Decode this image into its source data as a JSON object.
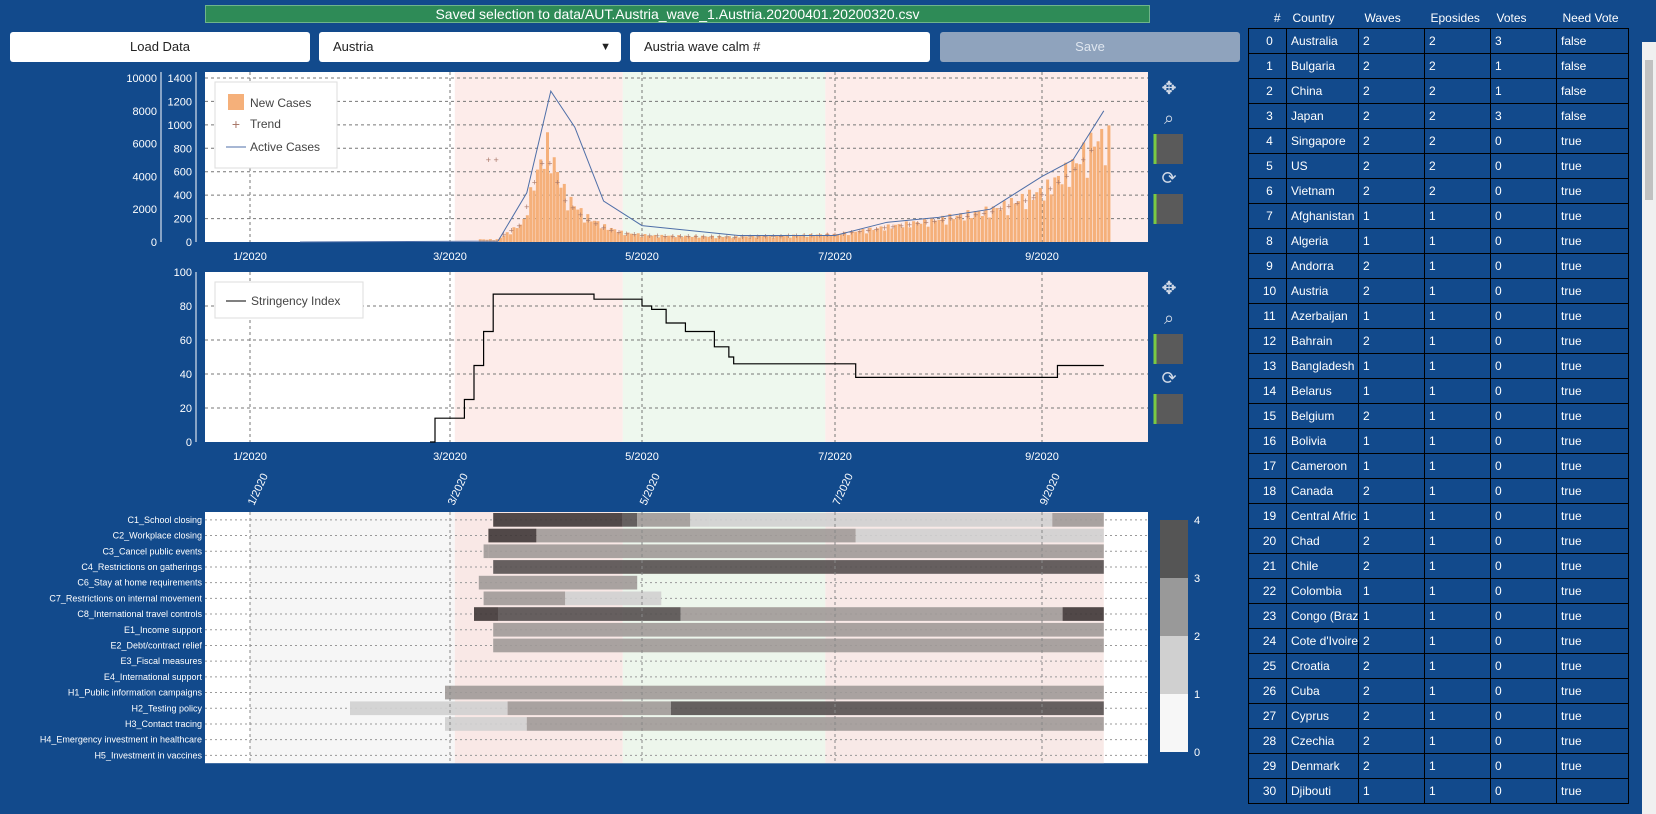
{
  "status_message": "Saved selection to data/AUT.Austria_wave_1.Austria.20200401.20200320.csv",
  "toolbar": {
    "load_label": "Load Data",
    "selected_country": "Austria",
    "name_value": "Austria wave calm #",
    "save_label": "Save"
  },
  "colors": {
    "bg": "#124a8c",
    "new_cases": "#f5b07a",
    "active": "#4f6fa8",
    "pink_band": "#fdecea",
    "green_band": "#eef8ee"
  },
  "icons": [
    "pan-icon",
    "zoom-icon",
    "save-icon",
    "reset-icon",
    "wheel-icon"
  ],
  "chart_data": [
    {
      "type": "bar",
      "title": "",
      "legend": [
        "New Cases",
        "Trend",
        "Active Cases"
      ],
      "x_ticks": [
        "1/2020",
        "3/2020",
        "5/2020",
        "7/2020",
        "9/2020"
      ],
      "y_left": [
        0,
        200,
        400,
        600,
        800,
        1000,
        1200,
        1400
      ],
      "y_right": [
        0,
        2000,
        4000,
        6000,
        8000,
        10000
      ],
      "ylim_left": [
        0,
        1400
      ],
      "ylim_right": [
        0,
        10000
      ],
      "new_cases": [
        [
          3.5,
          30
        ],
        [
          3.75,
          150
        ],
        [
          3.85,
          450
        ],
        [
          4.0,
          750
        ],
        [
          4.2,
          350
        ],
        [
          4.4,
          200
        ],
        [
          4.6,
          120
        ],
        [
          4.8,
          70
        ],
        [
          5.1,
          50
        ],
        [
          6.0,
          40
        ],
        [
          7.0,
          60
        ],
        [
          7.5,
          120
        ],
        [
          8.0,
          180
        ],
        [
          8.5,
          250
        ],
        [
          9.0,
          400
        ],
        [
          9.3,
          600
        ],
        [
          9.5,
          800
        ]
      ],
      "active_cases": [
        [
          3.5,
          50
        ],
        [
          3.8,
          3000
        ],
        [
          4.05,
          9200
        ],
        [
          4.3,
          7000
        ],
        [
          4.6,
          2500
        ],
        [
          5.0,
          1000
        ],
        [
          6.0,
          400
        ],
        [
          7.0,
          400
        ],
        [
          7.5,
          1200
        ],
        [
          8.0,
          1500
        ],
        [
          8.5,
          2000
        ],
        [
          9.0,
          4000
        ],
        [
          9.3,
          5000
        ],
        [
          9.6,
          8000
        ]
      ],
      "selection_bands": [
        "3/2020 - 4/2020 wave",
        "4/2020 - 7/2020 calm",
        "7/2020 - 9/2020 wave"
      ]
    },
    {
      "type": "line",
      "legend": [
        "Stringency Index"
      ],
      "x_ticks": [
        "1/2020",
        "3/2020",
        "5/2020",
        "7/2020",
        "9/2020"
      ],
      "y_ticks": [
        0,
        20,
        40,
        60,
        80,
        100
      ],
      "ylim": [
        0,
        100
      ],
      "stringency": [
        [
          2.8,
          0
        ],
        [
          2.85,
          14
        ],
        [
          3.1,
          14
        ],
        [
          3.15,
          25
        ],
        [
          3.25,
          45
        ],
        [
          3.35,
          65
        ],
        [
          3.45,
          87
        ],
        [
          4.45,
          87
        ],
        [
          4.5,
          84
        ],
        [
          4.9,
          84
        ],
        [
          5.0,
          80
        ],
        [
          5.1,
          78
        ],
        [
          5.25,
          70
        ],
        [
          5.45,
          65
        ],
        [
          5.75,
          56
        ],
        [
          5.9,
          50
        ],
        [
          5.95,
          46
        ],
        [
          6.95,
          46
        ],
        [
          7.2,
          38
        ],
        [
          9.1,
          38
        ],
        [
          9.15,
          45
        ],
        [
          9.6,
          45
        ]
      ]
    },
    {
      "type": "heatmap",
      "x_ticks": [
        "1/2020",
        "3/2020",
        "5/2020",
        "7/2020",
        "9/2020"
      ],
      "rows": [
        "C1_School closing",
        "C2_Workplace closing",
        "C3_Cancel public events",
        "C4_Restrictions on gatherings",
        "C6_Stay at home requirements",
        "C7_Restrictions on internal movement",
        "C8_International travel controls",
        "E1_Income support",
        "E2_Debt/contract relief",
        "E3_Fiscal measures",
        "E4_International support",
        "H1_Public information campaigns",
        "H2_Testing policy",
        "H3_Contact tracing",
        "H4_Emergency investment in healthcare",
        "H5_Investment in vaccines"
      ],
      "colorbar": [
        0,
        1,
        2,
        3,
        4
      ],
      "segments": [
        [
          [
            3.45,
            4.8,
            4
          ],
          [
            4.8,
            4.95,
            3
          ],
          [
            4.95,
            5.5,
            2
          ],
          [
            5.5,
            5.7,
            1
          ],
          [
            5.7,
            9.1,
            1
          ],
          [
            9.1,
            9.6,
            2
          ]
        ],
        [
          [
            3.4,
            3.9,
            4
          ],
          [
            3.9,
            7.2,
            2
          ],
          [
            7.2,
            9.6,
            1
          ]
        ],
        [
          [
            3.35,
            3.4,
            2
          ],
          [
            3.4,
            9.6,
            2
          ]
        ],
        [
          [
            3.45,
            9.6,
            3
          ]
        ],
        [
          [
            3.3,
            4.95,
            2
          ]
        ],
        [
          [
            3.35,
            4.2,
            2
          ],
          [
            4.2,
            5.2,
            1
          ]
        ],
        [
          [
            3.25,
            3.5,
            4
          ],
          [
            3.5,
            5.4,
            3
          ],
          [
            5.4,
            9.2,
            2
          ],
          [
            9.2,
            9.6,
            4
          ]
        ],
        [
          [
            3.45,
            9.6,
            2
          ]
        ],
        [
          [
            3.45,
            9.6,
            2
          ]
        ],
        [],
        [],
        [
          [
            2.95,
            9.6,
            2
          ]
        ],
        [
          [
            2.0,
            3.6,
            1
          ],
          [
            3.6,
            5.3,
            2
          ],
          [
            5.3,
            9.6,
            3
          ]
        ],
        [
          [
            2.95,
            3.8,
            1
          ],
          [
            3.8,
            9.6,
            2
          ]
        ],
        [],
        []
      ]
    }
  ],
  "table": {
    "headers": [
      "#",
      "Country",
      "Waves",
      "Eposides",
      "Votes",
      "Need Vote"
    ],
    "rows": [
      [
        "0",
        "Australia",
        "2",
        "2",
        "3",
        "false"
      ],
      [
        "1",
        "Bulgaria",
        "2",
        "2",
        "1",
        "false"
      ],
      [
        "2",
        "China",
        "2",
        "2",
        "1",
        "false"
      ],
      [
        "3",
        "Japan",
        "2",
        "2",
        "3",
        "false"
      ],
      [
        "4",
        "Singapore",
        "2",
        "2",
        "0",
        "true"
      ],
      [
        "5",
        "US",
        "2",
        "2",
        "0",
        "true"
      ],
      [
        "6",
        "Vietnam",
        "2",
        "2",
        "0",
        "true"
      ],
      [
        "7",
        "Afghanistan",
        "1",
        "1",
        "0",
        "true"
      ],
      [
        "8",
        "Algeria",
        "1",
        "1",
        "0",
        "true"
      ],
      [
        "9",
        "Andorra",
        "2",
        "1",
        "0",
        "true"
      ],
      [
        "10",
        "Austria",
        "2",
        "1",
        "0",
        "true"
      ],
      [
        "11",
        "Azerbaijan",
        "1",
        "1",
        "0",
        "true"
      ],
      [
        "12",
        "Bahrain",
        "2",
        "1",
        "0",
        "true"
      ],
      [
        "13",
        "Bangladesh",
        "1",
        "1",
        "0",
        "true"
      ],
      [
        "14",
        "Belarus",
        "1",
        "1",
        "0",
        "true"
      ],
      [
        "15",
        "Belgium",
        "2",
        "1",
        "0",
        "true"
      ],
      [
        "16",
        "Bolivia",
        "1",
        "1",
        "0",
        "true"
      ],
      [
        "17",
        "Cameroon",
        "1",
        "1",
        "0",
        "true"
      ],
      [
        "18",
        "Canada",
        "2",
        "1",
        "0",
        "true"
      ],
      [
        "19",
        "Central Afric",
        "1",
        "1",
        "0",
        "true"
      ],
      [
        "20",
        "Chad",
        "2",
        "1",
        "0",
        "true"
      ],
      [
        "21",
        "Chile",
        "2",
        "1",
        "0",
        "true"
      ],
      [
        "22",
        "Colombia",
        "1",
        "1",
        "0",
        "true"
      ],
      [
        "23",
        "Congo (Braz",
        "1",
        "1",
        "0",
        "true"
      ],
      [
        "24",
        "Cote d'Ivoire",
        "2",
        "1",
        "0",
        "true"
      ],
      [
        "25",
        "Croatia",
        "2",
        "1",
        "0",
        "true"
      ],
      [
        "26",
        "Cuba",
        "2",
        "1",
        "0",
        "true"
      ],
      [
        "27",
        "Cyprus",
        "2",
        "1",
        "0",
        "true"
      ],
      [
        "28",
        "Czechia",
        "2",
        "1",
        "0",
        "true"
      ],
      [
        "29",
        "Denmark",
        "2",
        "1",
        "0",
        "true"
      ],
      [
        "30",
        "Djibouti",
        "1",
        "1",
        "0",
        "true"
      ]
    ]
  }
}
